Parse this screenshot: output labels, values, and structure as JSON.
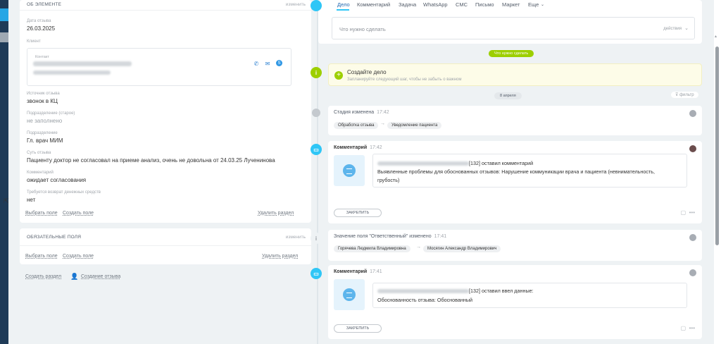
{
  "about": {
    "header": "ОБ ЭЛЕМЕНТЕ",
    "change": "изменить",
    "date_label": "Дата отзыва",
    "date_value": "26.03.2025",
    "client_label": "Клиент",
    "contact_label": "Контакт",
    "source_label": "Источник отзыва",
    "source_value": "звонок в КЦ",
    "dept_old_label": "Подразделение (старое)",
    "dept_old_value": "не заполнено",
    "dept_label": "Подразделение",
    "dept_value": "Гл. врач МИМ",
    "essence_label": "Суть отзыва",
    "essence_value": "Пациенту доктор не согласовал на приеме анализ, очень не довольна от 24.03.25 Лученинова",
    "comment_label": "Комментарий",
    "comment_value": "ожидает согласования",
    "refund_label": "Требуется возврат денежных средств",
    "refund_value": "нет",
    "select_field": "Выбрать поле",
    "create_field": "Создать поле",
    "delete_section": "Удалить раздел"
  },
  "required": {
    "header": "ОБЯЗАТЕЛЬНЫЕ ПОЛЯ",
    "change": "изменить",
    "select_field": "Выбрать поле",
    "create_field": "Создать поле",
    "delete_section": "Удалить раздел"
  },
  "bottom": {
    "create_section": "Создать раздел",
    "create_review": "Создание отзыва"
  },
  "tabs": [
    "Дело",
    "Комментарий",
    "Задача",
    "WhatsApp",
    "СМС",
    "Письмо",
    "Маркет",
    "Еще"
  ],
  "todo": {
    "placeholder": "Что нужно сделать",
    "actions": "действия"
  },
  "todo_pill": "Что нужно сделать",
  "create_task": {
    "title": "Создайте дело",
    "subtitle": "Запланируйте следующий шаг, чтобы не забыть о важном"
  },
  "date_pill": "8 апреля",
  "filter": "фильтр",
  "events": {
    "stage": {
      "title": "Стадия изменена",
      "time": "17:42",
      "from": "Обработка отзыва",
      "to": "Уведомление пациента"
    },
    "comment1": {
      "title": "Комментарий",
      "time": "17:42",
      "line1": "[132] оставил комментарий",
      "line2": "Выявленные проблемы для обоснованных отзывов: Нарушение коммуникации врача и пациента (невнимательность,",
      "line3": "грубость)",
      "pin": "ЗАКРЕПИТЬ"
    },
    "field_change": {
      "title": "Значение поля \"Ответственный\" изменено",
      "time": "17:41",
      "from": "Горячева Людмила Владимировна",
      "to": "Мосягин Александр Владимирович"
    },
    "comment2": {
      "title": "Комментарий",
      "time": "17:41",
      "line1": "[132] оставил ввел данные:",
      "line2": "Обоснованность отзыва: Обоснованный",
      "pin": "ЗАКРЕПИТЬ"
    }
  },
  "colors": {
    "accent_blue": "#2fc6f6",
    "green": "#9dcf00",
    "dark_strip": "#1f3b58"
  }
}
